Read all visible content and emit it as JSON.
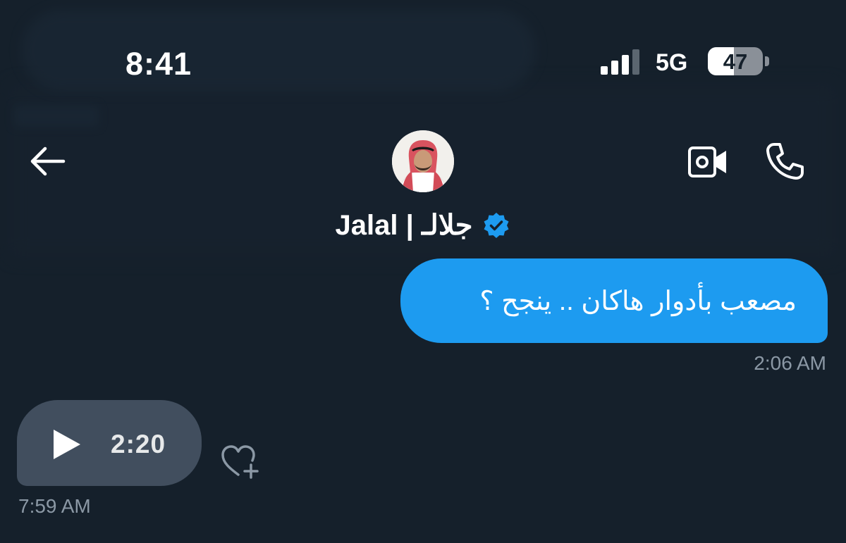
{
  "status_bar": {
    "time": "8:41",
    "network": "5G",
    "battery": "47",
    "battery_level_percent": 47
  },
  "header": {
    "back_icon": "arrow-left-icon",
    "contact_name": "Jalal | جلالـ",
    "verified_icon": "verified-badge-icon",
    "video_call_icon": "video-camera-icon",
    "voice_call_icon": "phone-icon"
  },
  "messages": [
    {
      "direction": "sent",
      "text": "مصعب بأدوار هاكان .. ينجح ؟",
      "time": "2:06 AM"
    },
    {
      "direction": "received",
      "type": "audio",
      "duration": "2:20",
      "play_icon": "play-icon",
      "react_icon": "heart-plus-icon",
      "time": "7:59 AM"
    }
  ],
  "colors": {
    "background": "#15202b",
    "sent_bubble": "#1d9bf0",
    "received_bubble": "#414e5e",
    "verified": "#1d9bf0",
    "secondary_text": "#8b98a5"
  }
}
